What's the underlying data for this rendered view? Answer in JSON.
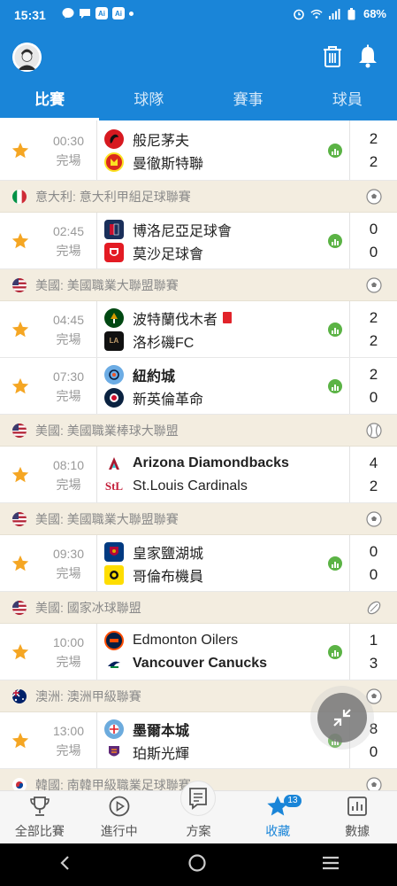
{
  "status_bar": {
    "time": "15:31",
    "battery": "68%"
  },
  "header": {
    "tabs": [
      "比賽",
      "球隊",
      "賽事",
      "球員"
    ]
  },
  "colors": {
    "brand": "#1a85d8",
    "star": "#f5a623",
    "stats": "#5bb345",
    "red_card": "#e1232a"
  },
  "leagues": [
    {
      "label": "意大利: 意大利甲組足球聯賽",
      "flag": "italy",
      "sport": "soccer-ball-icon"
    },
    {
      "label": "美國: 美國職業大聯盟聯賽",
      "flag": "usa",
      "sport": "soccer-ball-icon"
    },
    {
      "label": "美國: 美國職業棒球大聯盟",
      "flag": "usa",
      "sport": "baseball-icon"
    },
    {
      "label": "美國: 美國職業大聯盟聯賽",
      "flag": "usa",
      "sport": "soccer-ball-icon"
    },
    {
      "label": "美國: 國家冰球聯盟",
      "flag": "usa",
      "sport": "hockey-puck-icon"
    },
    {
      "label": "澳洲: 澳洲甲級聯賽",
      "flag": "australia",
      "sport": "soccer-ball-icon"
    },
    {
      "label": "韓國: 南韓甲級職業足球聯賽",
      "flag": "korea",
      "sport": "soccer-ball-icon"
    }
  ],
  "matches": [
    {
      "time": "00:30",
      "status": "完場",
      "home": "般尼茅夫",
      "away": "曼徹斯特聯",
      "home_score": "2",
      "away_score": "2"
    },
    {
      "time": "02:45",
      "status": "完場",
      "home": "博洛尼亞足球會",
      "away": "莫沙足球會",
      "home_score": "0",
      "away_score": "0"
    },
    {
      "time": "04:45",
      "status": "完場",
      "home": "波特蘭伐木者",
      "away": "洛杉磯FC",
      "home_score": "2",
      "away_score": "2"
    },
    {
      "time": "07:30",
      "status": "完場",
      "home": "紐約城",
      "away": "新英倫革命",
      "home_score": "2",
      "away_score": "0"
    },
    {
      "time": "08:10",
      "status": "完場",
      "home": "Arizona Diamondbacks",
      "away": "St.Louis Cardinals",
      "home_score": "4",
      "away_score": "2"
    },
    {
      "time": "09:30",
      "status": "完場",
      "home": "皇家鹽湖城",
      "away": "哥倫布機員",
      "home_score": "0",
      "away_score": "0"
    },
    {
      "time": "10:00",
      "status": "完場",
      "home": "Edmonton Oilers",
      "away": "Vancouver Canucks",
      "home_score": "1",
      "away_score": "3"
    },
    {
      "time": "13:00",
      "status": "完場",
      "home": "墨爾本城",
      "away": "珀斯光輝",
      "home_score": "8",
      "away_score": "0"
    }
  ],
  "bottom_nav": {
    "items": [
      "全部比賽",
      "進行中",
      "方案",
      "收藏",
      "數據"
    ],
    "favorites_badge": "13"
  }
}
